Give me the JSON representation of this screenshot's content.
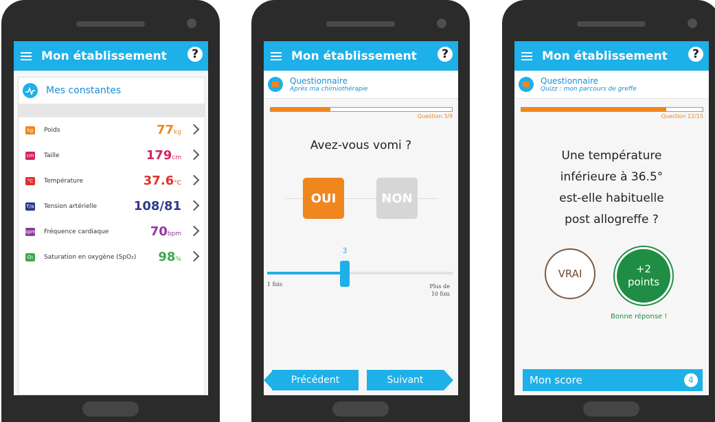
{
  "app_title": "Mon établissement",
  "screen1": {
    "section_title": "Mes constantes",
    "rows": [
      {
        "badge": "kg",
        "label": "Poids",
        "value": "77",
        "unit": "kg",
        "color": "#f0861e"
      },
      {
        "badge": "cm",
        "label": "Taille",
        "value": "179",
        "unit": "cm",
        "color": "#d6245e"
      },
      {
        "badge": "°C",
        "label": "Température",
        "value": "37.6",
        "unit": "°C",
        "color": "#e0312c"
      },
      {
        "badge": "T/a",
        "label": "Tension artérielle",
        "value": "108/81",
        "unit": "",
        "color": "#2e3a8c"
      },
      {
        "badge": "bpm",
        "label": "Fréquence cardiaque",
        "value": "70",
        "unit": "bpm",
        "color": "#8e3aa0"
      },
      {
        "badge": "O₂",
        "label": "Saturation en oxygène (SpO₂)",
        "value": "98",
        "unit": "%",
        "color": "#3daa4c"
      }
    ]
  },
  "screen2": {
    "title": "Questionnaire",
    "subtitle": "Après ma chimiothérapie",
    "progress_label": "Question 3/9",
    "progress_fraction": 0.33,
    "question": "Avez-vous vomi ?",
    "yes_label": "OUI",
    "no_label": "NON",
    "slider_value": "3",
    "slider_fraction": 0.42,
    "slider_min": "1 fois",
    "slider_max_line1": "Plus de",
    "slider_max_line2": "10 fois",
    "prev_label": "Précédent",
    "next_label": "Suivant"
  },
  "screen3": {
    "title": "Questionnaire",
    "subtitle": "Quizz : mon parcours de greffe",
    "progress_label": "Question 12/15",
    "progress_fraction": 0.8,
    "question_lines": [
      "Une température",
      "inférieure à 36.5°",
      "est-elle habituelle",
      "post allogreffe ?"
    ],
    "true_label": "VRAI",
    "points_line1": "+2",
    "points_line2": "points",
    "feedback": "Bonne réponse !",
    "score_label": "Mon score",
    "score_value": "4"
  }
}
